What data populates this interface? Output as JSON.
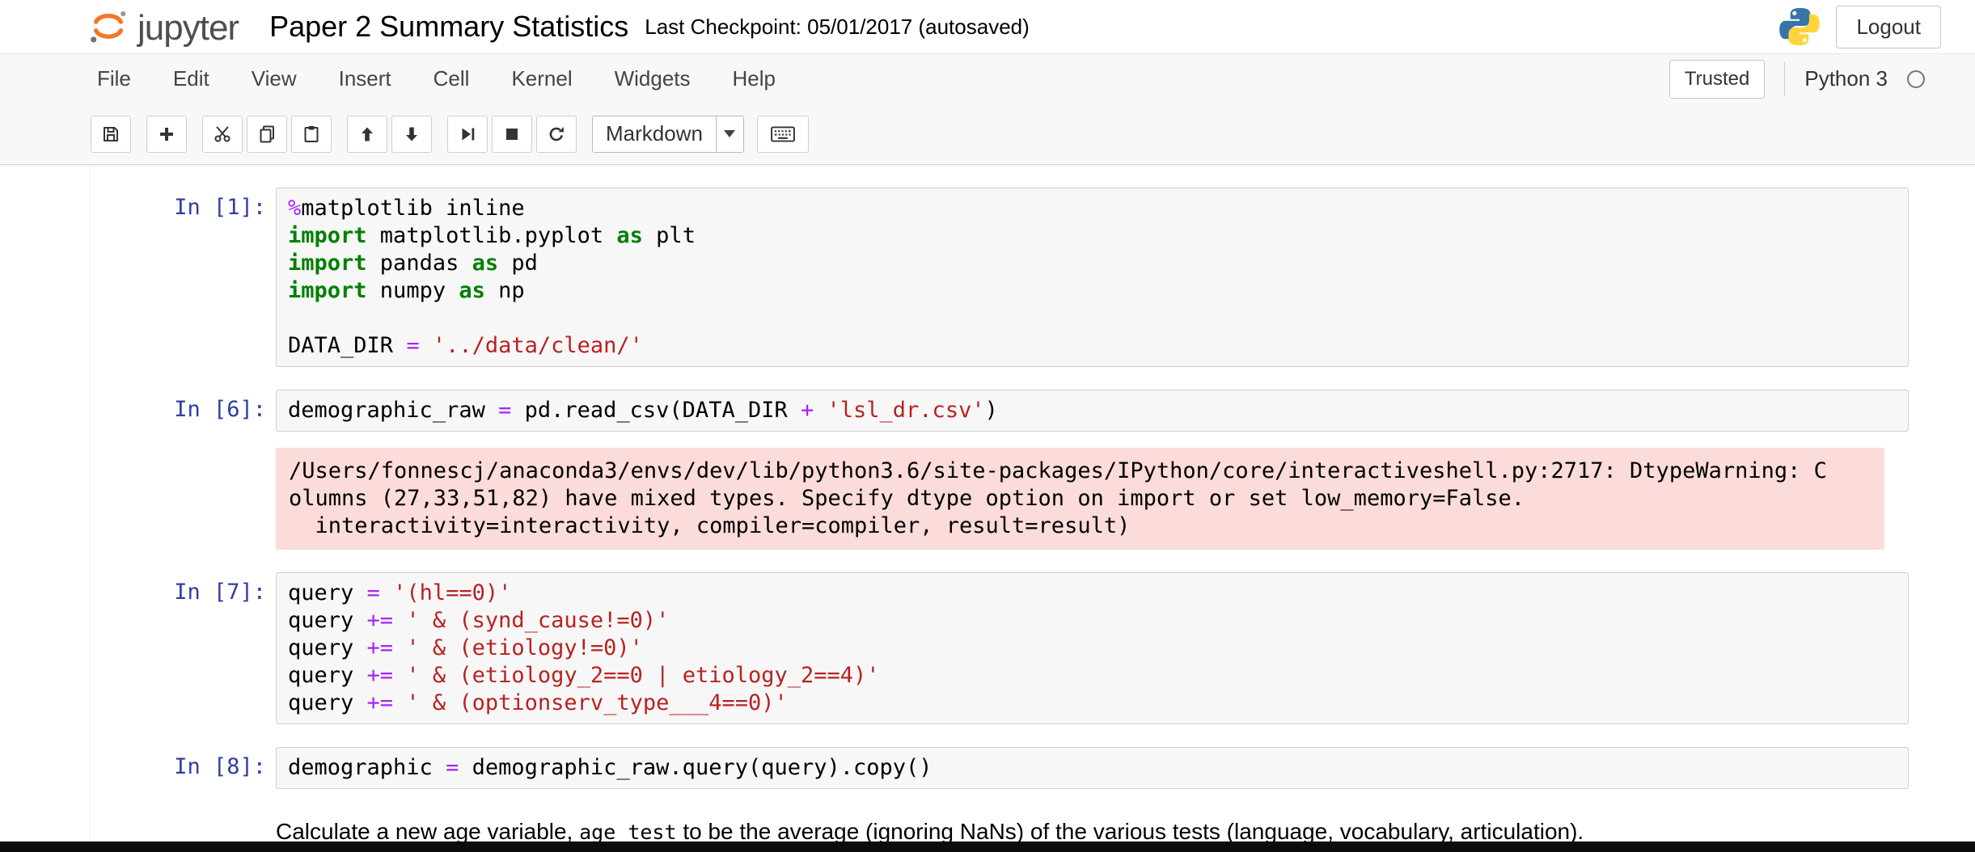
{
  "header": {
    "logo_text": "jupyter",
    "title": "Paper 2 Summary Statistics",
    "checkpoint": "Last Checkpoint: 05/01/2017 (autosaved)",
    "logout_label": "Logout"
  },
  "menubar": {
    "items": [
      "File",
      "Edit",
      "View",
      "Insert",
      "Cell",
      "Kernel",
      "Widgets",
      "Help"
    ],
    "trusted_label": "Trusted",
    "kernel_name": "Python 3"
  },
  "toolbar": {
    "celltype_value": "Markdown"
  },
  "colors": {
    "keyword": "#008000",
    "string": "#BA2121",
    "operator": "#AA22FF",
    "prompt": "#303F9F",
    "stderr_bg": "#fbdcda",
    "jupyter_orange": "#F37726"
  },
  "cells": [
    {
      "type": "code",
      "prompt": "In [1]:",
      "lines": [
        [
          [
            "op",
            "%"
          ],
          [
            "tx",
            "matplotlib inline"
          ]
        ],
        [
          [
            "kw",
            "import"
          ],
          [
            "tx",
            " matplotlib.pyplot "
          ],
          [
            "kw",
            "as"
          ],
          [
            "tx",
            " plt"
          ]
        ],
        [
          [
            "kw",
            "import"
          ],
          [
            "tx",
            " pandas "
          ],
          [
            "kw",
            "as"
          ],
          [
            "tx",
            " pd"
          ]
        ],
        [
          [
            "kw",
            "import"
          ],
          [
            "tx",
            " numpy "
          ],
          [
            "kw",
            "as"
          ],
          [
            "tx",
            " np"
          ]
        ],
        [],
        [
          [
            "tx",
            "DATA_DIR "
          ],
          [
            "op",
            "="
          ],
          [
            "tx",
            " "
          ],
          [
            "st",
            "'../data/clean/'"
          ]
        ]
      ]
    },
    {
      "type": "code",
      "prompt": "In [6]:",
      "lines": [
        [
          [
            "tx",
            "demographic_raw "
          ],
          [
            "op",
            "="
          ],
          [
            "tx",
            " pd.read_csv(DATA_DIR "
          ],
          [
            "op",
            "+"
          ],
          [
            "tx",
            " "
          ],
          [
            "st",
            "'lsl_dr.csv'"
          ],
          [
            "tx",
            ")"
          ]
        ]
      ],
      "output": {
        "kind": "stderr",
        "lines": [
          "/Users/fonnescj/anaconda3/envs/dev/lib/python3.6/site-packages/IPython/core/interactiveshell.py:2717: DtypeWarning: C",
          "olumns (27,33,51,82) have mixed types. Specify dtype option on import or set low_memory=False.",
          "  interactivity=interactivity, compiler=compiler, result=result)"
        ]
      }
    },
    {
      "type": "code",
      "prompt": "In [7]:",
      "lines": [
        [
          [
            "tx",
            "query "
          ],
          [
            "op",
            "="
          ],
          [
            "tx",
            " "
          ],
          [
            "st",
            "'(hl==0)'"
          ]
        ],
        [
          [
            "tx",
            "query "
          ],
          [
            "op",
            "+="
          ],
          [
            "tx",
            " "
          ],
          [
            "st",
            "' & (synd_cause!=0)'"
          ]
        ],
        [
          [
            "tx",
            "query "
          ],
          [
            "op",
            "+="
          ],
          [
            "tx",
            " "
          ],
          [
            "st",
            "' & (etiology!=0)'"
          ]
        ],
        [
          [
            "tx",
            "query "
          ],
          [
            "op",
            "+="
          ],
          [
            "tx",
            " "
          ],
          [
            "st",
            "' & (etiology_2==0 | etiology_2==4)'"
          ]
        ],
        [
          [
            "tx",
            "query "
          ],
          [
            "op",
            "+="
          ],
          [
            "tx",
            " "
          ],
          [
            "st",
            "' & (optionserv_type___4==0)'"
          ]
        ]
      ]
    },
    {
      "type": "code",
      "prompt": "In [8]:",
      "lines": [
        [
          [
            "tx",
            "demographic "
          ],
          [
            "op",
            "="
          ],
          [
            "tx",
            " demographic_raw.query(query).copy()"
          ]
        ]
      ]
    },
    {
      "type": "markdown",
      "segments": [
        [
          "tx",
          "Calculate a new age variable, "
        ],
        [
          "code",
          "age_test"
        ],
        [
          "tx",
          " to be the average (ignoring NaNs) of the various tests (language, vocabulary, articulation)."
        ]
      ]
    }
  ]
}
